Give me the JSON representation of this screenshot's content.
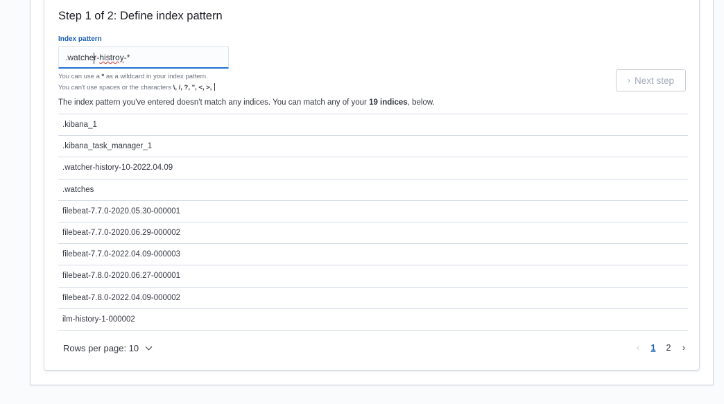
{
  "step": {
    "title": "Step 1 of 2: Define index pattern"
  },
  "index_pattern": {
    "label": "Index pattern",
    "value_prefix": ".watcher-",
    "value_misspelled": "histroy",
    "value_suffix": "-*"
  },
  "help": {
    "line1_a": "You can use a ",
    "line1_star": "*",
    "line1_b": " as a wildcard in your index pattern.",
    "line2_a": "You can't use spaces or the characters ",
    "line2_chars": "\\, /, ?, \", <, >,",
    "line2_b": " "
  },
  "next_step": {
    "label": "Next step",
    "icon": "chevron-right-icon"
  },
  "message": {
    "text_a": "The index pattern you've entered doesn't match any indices. You can match any of your ",
    "count": "19 indices",
    "text_b": ", below."
  },
  "indices": [
    ".kibana_1",
    ".kibana_task_manager_1",
    ".watcher-history-10-2022.04.09",
    ".watches",
    "filebeat-7.7.0-2020.05.30-000001",
    "filebeat-7.7.0-2020.06.29-000002",
    "filebeat-7.7.0-2022.04.09-000003",
    "filebeat-7.8.0-2020.06.27-000001",
    "filebeat-7.8.0-2022.04.09-000002",
    "ilm-history-1-000002"
  ],
  "pagination": {
    "rows_per_page": "Rows per page: 10",
    "pages": [
      "1",
      "2"
    ],
    "current": "1"
  }
}
